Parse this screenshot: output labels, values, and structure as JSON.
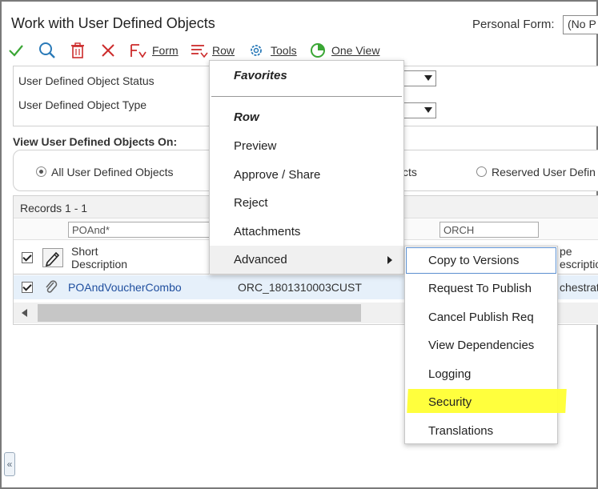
{
  "header": {
    "title": "Work with User Defined Objects",
    "personal_form_label": "Personal Form:",
    "personal_form_value": "(No P"
  },
  "toolbar": {
    "form_label": "Form",
    "row_label": "Row",
    "tools_label": "Tools",
    "one_view_label": "One View"
  },
  "filters": {
    "status_label": "User Defined Object Status",
    "type_label": "User Defined Object Type"
  },
  "view_on": {
    "label": "View User Defined Objects On:",
    "options": [
      "All User Defined Objects",
      "cts",
      "Reserved User Defin"
    ],
    "selected": "All User Defined Objects"
  },
  "grid": {
    "records_label": "Records 1 - 1",
    "filter_values": [
      "POAnd*",
      "ORCH"
    ],
    "columns": [
      "Short\nDescription",
      "pe\nescription"
    ],
    "col_short": "Short",
    "col_short2": "Description",
    "col_type": "pe",
    "col_type2": "escription",
    "rows": [
      {
        "short_description": "POAndVoucherCombo",
        "object_name": "ORC_1801310003CUST",
        "type_desc": "chestrati"
      }
    ]
  },
  "row_menu": {
    "favorites": "Favorites",
    "row_header": "Row",
    "items": [
      "Preview",
      "Approve / Share",
      "Reject",
      "Attachments",
      "Advanced"
    ]
  },
  "advanced_menu": {
    "items": [
      "Copy to Versions",
      "Request To Publish",
      "Cancel Publish Req",
      "View Dependencies",
      "Logging",
      "Security",
      "Translations"
    ]
  },
  "colors": {
    "accent_green": "#3aa635",
    "accent_blue": "#2a7ab8",
    "accent_red": "#cc2b2b",
    "link": "#1f4e9e",
    "highlight": "#ffff33"
  }
}
